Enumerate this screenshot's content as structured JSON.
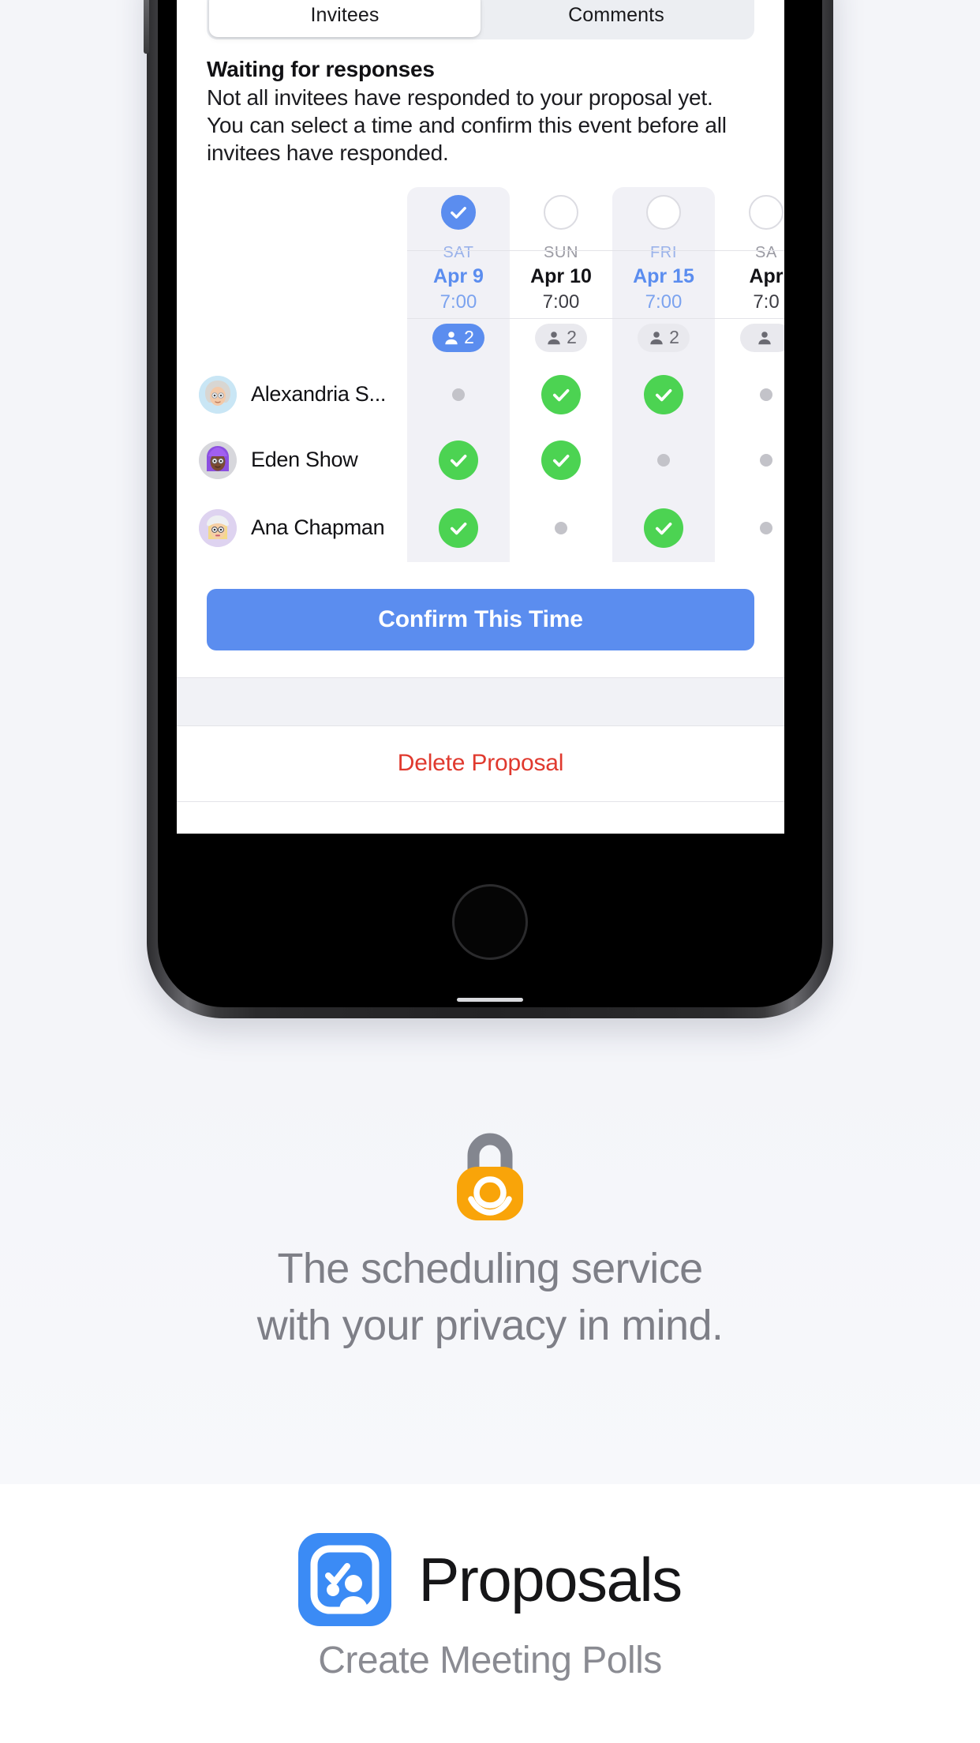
{
  "phone": {
    "segmented": {
      "tabs": [
        {
          "label": "Invitees",
          "active": true
        },
        {
          "label": "Comments",
          "active": false
        }
      ]
    },
    "info": {
      "heading": "Waiting for responses",
      "body": "Not all invitees have responded to your proposal yet. You can select a time and confirm this event before all invitees have responded."
    },
    "grid": {
      "columns": [
        {
          "dow": "SAT",
          "date": "Apr 9",
          "time": "7:00",
          "selected": true,
          "count": "2"
        },
        {
          "dow": "SUN",
          "date": "Apr 10",
          "time": "7:00",
          "selected": false,
          "count": "2"
        },
        {
          "dow": "FRI",
          "date": "Apr 15",
          "time": "7:00",
          "selected": false,
          "count": "2"
        },
        {
          "dow": "SA",
          "date": "Apr",
          "time": "7:0",
          "selected": false,
          "count": ""
        }
      ],
      "rows": [
        {
          "name": "Alexandria S...",
          "responses": [
            "none",
            "yes",
            "yes",
            "none"
          ]
        },
        {
          "name": "Eden Show",
          "responses": [
            "yes",
            "yes",
            "none",
            "none"
          ]
        },
        {
          "name": "Ana Chapman",
          "responses": [
            "yes",
            "none",
            "yes",
            "none"
          ]
        }
      ]
    },
    "confirm_label": "Confirm This Time",
    "delete_label": "Delete Proposal"
  },
  "promo": {
    "tagline_line1": "The scheduling service",
    "tagline_line2": "with your privacy in mind."
  },
  "footer": {
    "title": "Proposals",
    "subtitle": "Create Meeting Polls"
  },
  "colors": {
    "accent_blue": "#5b8def",
    "app_icon_blue": "#3b8bf5",
    "yes_green": "#4cd352",
    "delete_red": "#e0392e",
    "lock_orange": "#f9a409",
    "page_bg": "#f4f5f9"
  }
}
